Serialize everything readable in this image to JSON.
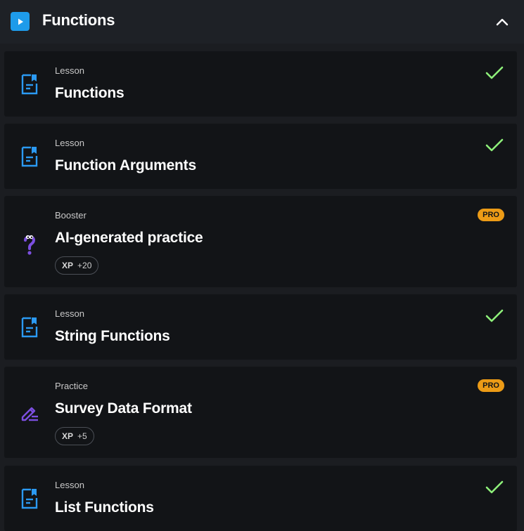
{
  "header": {
    "title": "Functions",
    "icon": "play-icon",
    "collapse_icon": "chevron-up-icon",
    "accent": "#1e9bea"
  },
  "items": [
    {
      "type": "Lesson",
      "title": "Functions",
      "status": "completed",
      "icon": "lesson-document-icon"
    },
    {
      "type": "Lesson",
      "title": "Function Arguments",
      "status": "completed",
      "icon": "lesson-document-icon"
    },
    {
      "type": "Booster",
      "title": "AI-generated practice",
      "badge": "PRO",
      "xp_label": "XP",
      "xp_value": "+20",
      "icon": "question-mark-icon"
    },
    {
      "type": "Lesson",
      "title": "String Functions",
      "status": "completed",
      "icon": "lesson-document-icon"
    },
    {
      "type": "Practice",
      "title": "Survey Data Format",
      "badge": "PRO",
      "xp_label": "XP",
      "xp_value": "+5",
      "icon": "pencil-icon"
    },
    {
      "type": "Lesson",
      "title": "List Functions",
      "status": "completed",
      "icon": "lesson-document-icon"
    }
  ],
  "colors": {
    "check": "#8ef07a",
    "pro_badge": "#ec9b16",
    "lesson_icon": "#2b9af3",
    "booster_icon": "#7c4fe0",
    "card_bg": "#121417",
    "page_bg": "#1b1d21"
  }
}
